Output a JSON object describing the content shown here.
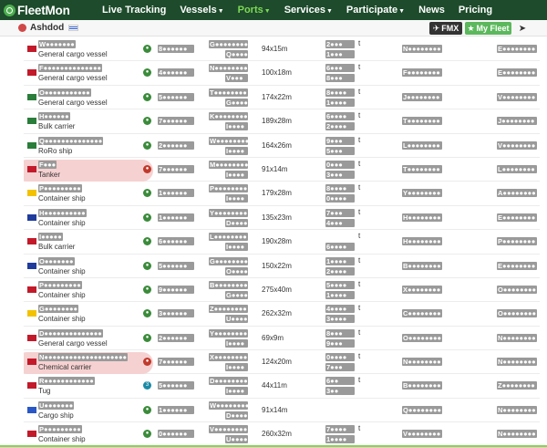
{
  "app": {
    "logo": "FleetMon",
    "menu": [
      {
        "label": "Live Tracking",
        "caret": false,
        "active": false
      },
      {
        "label": "Vessels",
        "caret": true,
        "active": false
      },
      {
        "label": "Ports",
        "caret": true,
        "active": true
      },
      {
        "label": "Services",
        "caret": true,
        "active": false
      },
      {
        "label": "Participate",
        "caret": true,
        "active": false
      },
      {
        "label": "News",
        "caret": false,
        "active": false
      },
      {
        "label": "Pricing",
        "caret": false,
        "active": false
      }
    ]
  },
  "port": {
    "name": "Ashdod",
    "flag": "israel-flag"
  },
  "actions": {
    "fmx": "FMX",
    "fleet": "My Fleet",
    "fmx_icon": "plane-icon",
    "fleet_icon": "star-icon",
    "send_icon": "send-icon"
  },
  "colors": {
    "nav": "#1d4b2b",
    "accent": "#7ed957",
    "highlight": "#f6d1d1",
    "green_btn": "#5cb85c"
  },
  "vessels": [
    {
      "name": "W●●●●●●●",
      "type": "General cargo vessel",
      "status": "green",
      "a": "8●●●●●●",
      "b1": "G●●●●●●●●",
      "b2": "Q●●●●",
      "dim": "94x15m",
      "d1": "2●●●",
      "d2": "1●●●",
      "t": "t",
      "e": "N●●●●●●●●",
      "f": "E●●●●●●●●",
      "flag": "#c21a2a",
      "hl": false
    },
    {
      "name": "F●●●●●●●●●●●●●●",
      "type": "General cargo vessel",
      "status": "green",
      "a": "4●●●●●●",
      "b1": "N●●●●●●●●",
      "b2": "V●●●",
      "dim": "100x18m",
      "d1": "6●●●",
      "d2": "8●●●",
      "t": "t",
      "e": "F●●●●●●●●",
      "f": "E●●●●●●●●",
      "flag": "#c21a2a",
      "hl": false
    },
    {
      "name": "O●●●●●●●●●●●",
      "type": "General cargo vessel",
      "status": "green",
      "a": "5●●●●●●",
      "b1": "T●●●●●●●●",
      "b2": "G●●●●",
      "dim": "174x22m",
      "d1": "8●●●●",
      "d2": "1●●●●",
      "t": "t",
      "e": "J●●●●●●●●",
      "f": "V●●●●●●●●",
      "flag": "#2a7d3a",
      "hl": false
    },
    {
      "name": "H●●●●●●",
      "type": "Bulk carrier",
      "status": "green",
      "a": "7●●●●●●",
      "b1": "K●●●●●●●●",
      "b2": "I●●●●",
      "dim": "189x28m",
      "d1": "6●●●●",
      "d2": "2●●●●",
      "t": "t",
      "e": "T●●●●●●●●",
      "f": "J●●●●●●●●",
      "flag": "#2a7d3a",
      "hl": false
    },
    {
      "name": "Q●●●●●●●●●●●●●●",
      "type": "RoRo ship",
      "status": "green",
      "a": "2●●●●●●",
      "b1": "W●●●●●●●●",
      "b2": "I●●●●",
      "dim": "164x26m",
      "d1": "9●●●",
      "d2": "5●●●",
      "t": "t",
      "e": "L●●●●●●●●",
      "f": "V●●●●●●●●",
      "flag": "#2a7d3a",
      "hl": false
    },
    {
      "name": "F●●●",
      "type": "Tanker",
      "status": "red",
      "a": "7●●●●●●",
      "b1": "M●●●●●●●●",
      "b2": "I●●●●",
      "dim": "91x14m",
      "d1": "0●●●",
      "d2": "3●●●",
      "t": "t",
      "e": "T●●●●●●●●",
      "f": "L●●●●●●●●",
      "flag": "#c21a2a",
      "hl": true
    },
    {
      "name": "P●●●●●●●●●",
      "type": "Container ship",
      "status": "green",
      "a": "1●●●●●●",
      "b1": "P●●●●●●●●",
      "b2": "I●●●●",
      "dim": "179x28m",
      "d1": "8●●●●",
      "d2": "0●●●●",
      "t": "t",
      "e": "Y●●●●●●●●",
      "f": "A●●●●●●●●",
      "flag": "#f2c200",
      "hl": false
    },
    {
      "name": "H●●●●●●●●●●",
      "type": "Container ship",
      "status": "green",
      "a": "1●●●●●●",
      "b1": "Y●●●●●●●●",
      "b2": "D●●●●",
      "dim": "135x23m",
      "d1": "7●●●",
      "d2": "4●●●",
      "t": "t",
      "e": "H●●●●●●●●",
      "f": "E●●●●●●●●",
      "flag": "#1f3c9c",
      "hl": false
    },
    {
      "name": "I●●●●●",
      "type": "Bulk carrier",
      "status": "green",
      "a": "6●●●●●●",
      "b1": "L●●●●●●●●",
      "b2": "I●●●●",
      "dim": "190x28m",
      "d1": "",
      "d2": "6●●●●",
      "t": "t",
      "e": "H●●●●●●●●",
      "f": "P●●●●●●●●",
      "flag": "#c21a2a",
      "hl": false
    },
    {
      "name": "O●●●●●●●",
      "type": "Container ship",
      "status": "green",
      "a": "5●●●●●●",
      "b1": "G●●●●●●●●",
      "b2": "O●●●●",
      "dim": "150x22m",
      "d1": "1●●●●",
      "d2": "2●●●●",
      "t": "t",
      "e": "B●●●●●●●●",
      "f": "E●●●●●●●●",
      "flag": "#1f3c9c",
      "hl": false
    },
    {
      "name": "P●●●●●●●●●",
      "type": "Container ship",
      "status": "green",
      "a": "9●●●●●●",
      "b1": "B●●●●●●●●",
      "b2": "G●●●●",
      "dim": "275x40m",
      "d1": "5●●●●",
      "d2": "1●●●●",
      "t": "t",
      "e": "X●●●●●●●●",
      "f": "O●●●●●●●●",
      "flag": "#c21a2a",
      "hl": false
    },
    {
      "name": "G●●●●●●●●",
      "type": "Container ship",
      "status": "green",
      "a": "3●●●●●●",
      "b1": "Z●●●●●●●●",
      "b2": "U●●●●",
      "dim": "262x32m",
      "d1": "4●●●●",
      "d2": "3●●●●",
      "t": "t",
      "e": "C●●●●●●●●",
      "f": "O●●●●●●●●",
      "flag": "#f2c200",
      "hl": false
    },
    {
      "name": "D●●●●●●●●●●●●●●",
      "type": "General cargo vessel",
      "status": "green",
      "a": "2●●●●●●",
      "b1": "Y●●●●●●●●",
      "b2": "I●●●●",
      "dim": "69x9m",
      "d1": "8●●●",
      "d2": "9●●●",
      "t": "t",
      "e": "O●●●●●●●●",
      "f": "N●●●●●●●●",
      "flag": "#c21a2a",
      "hl": false
    },
    {
      "name": "N●●●●●●●●●●●●●●●●●●●●",
      "type": "Chemical carrier",
      "status": "red",
      "a": "7●●●●●●",
      "b1": "X●●●●●●●●",
      "b2": "I●●●●",
      "dim": "124x20m",
      "d1": "0●●●●",
      "d2": "7●●●",
      "t": "t",
      "e": "N●●●●●●●●",
      "f": "N●●●●●●●●",
      "flag": "#c21a2a",
      "hl": true
    },
    {
      "name": "R●●●●●●●●●●●●",
      "type": "Tug",
      "status": "teal",
      "a": "5●●●●●●",
      "b1": "D●●●●●●●●",
      "b2": "I●●●●",
      "dim": "44x11m",
      "d1": "6●●",
      "d2": "3●●",
      "t": "t",
      "e": "B●●●●●●●●",
      "f": "Z●●●●●●●●",
      "flag": "#c21a2a",
      "hl": false
    },
    {
      "name": "U●●●●●●●",
      "type": "Cargo ship",
      "status": "green",
      "a": "1●●●●●●",
      "b1": "W●●●●●●●●",
      "b2": "D●●●●",
      "dim": "91x14m",
      "d1": "",
      "d2": "",
      "t": "",
      "e": "Q●●●●●●●●",
      "f": "N●●●●●●●●",
      "flag": "#2a57c7",
      "hl": false
    },
    {
      "name": "P●●●●●●●●●",
      "type": "Container ship",
      "status": "green",
      "a": "0●●●●●●",
      "b1": "V●●●●●●●●",
      "b2": "U●●●●",
      "dim": "260x32m",
      "d1": "7●●●●",
      "d2": "1●●●●",
      "t": "t",
      "e": "V●●●●●●●●",
      "f": "N●●●●●●●●",
      "flag": "#c21a2a",
      "hl": false
    }
  ]
}
